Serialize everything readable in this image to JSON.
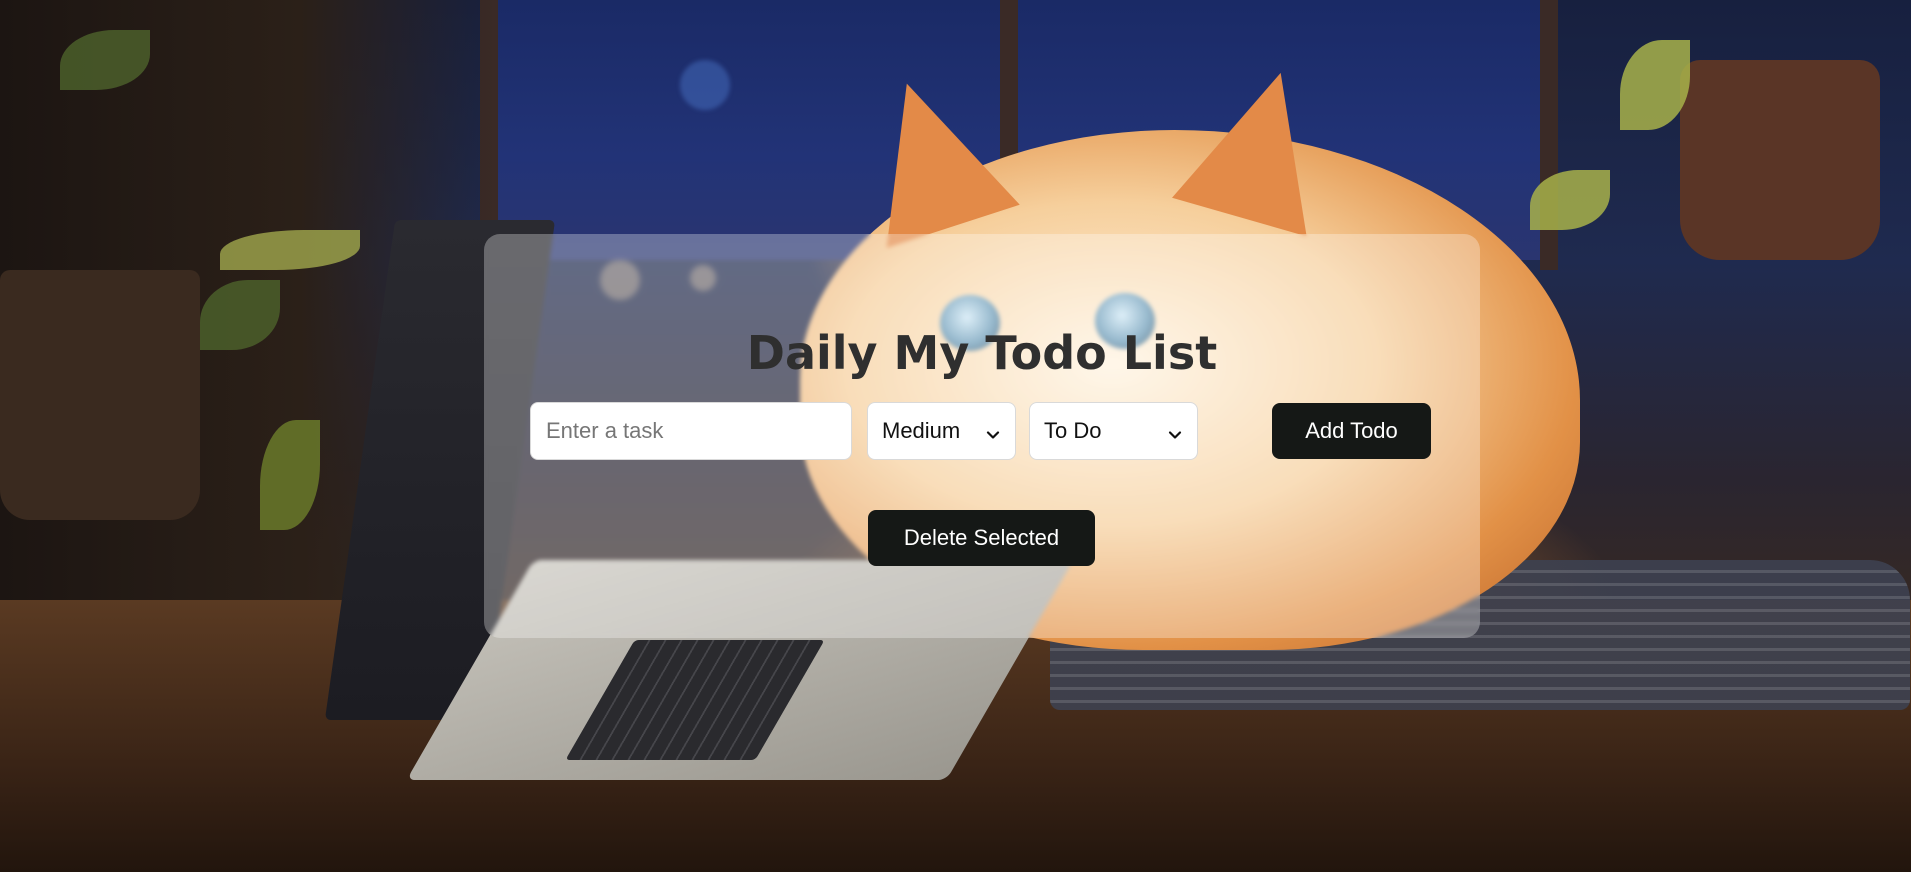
{
  "app": {
    "title": "Daily My Todo List"
  },
  "form": {
    "task_input": {
      "value": "",
      "placeholder": "Enter a task"
    },
    "priority_select": {
      "selected": "Medium"
    },
    "status_select": {
      "selected": "To Do"
    },
    "add_button_label": "Add Todo"
  },
  "actions": {
    "delete_selected_label": "Delete Selected"
  },
  "icons": {
    "priority_dropdown": "chevron-down-icon",
    "status_dropdown": "chevron-down-icon"
  },
  "colors": {
    "button_bg": "#151816",
    "button_text": "#ffffff",
    "title_text": "#2f2f2f",
    "panel_bg": "rgba(255,255,255,0.30)"
  }
}
